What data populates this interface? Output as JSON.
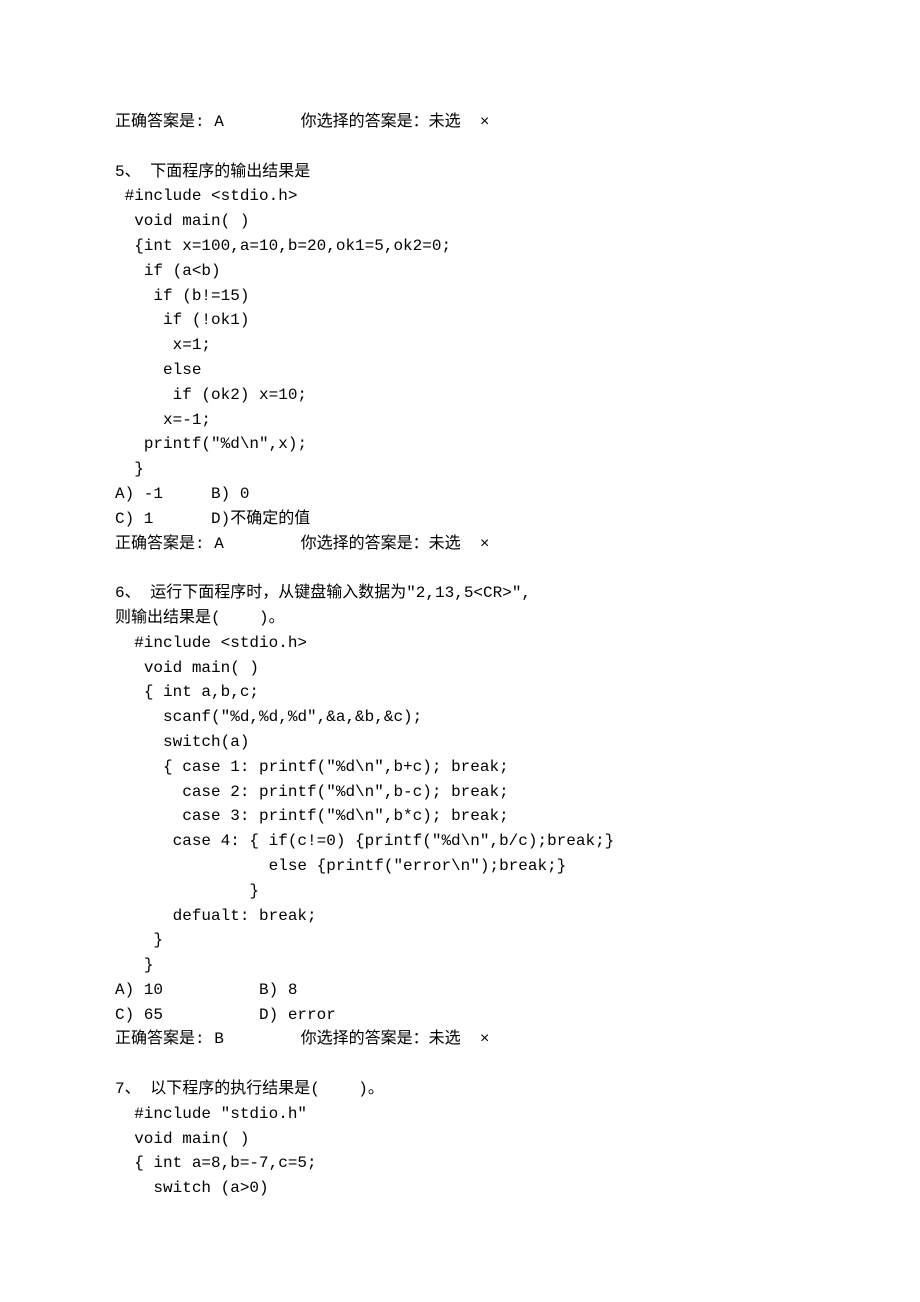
{
  "q4_answer": "正确答案是: A        你选择的答案是：未选  ×",
  "q5": {
    "title": "5、 下面程序的输出结果是",
    "code": " #include <stdio.h>\n  void main( )\n  {int x=100,a=10,b=20,ok1=5,ok2=0;\n   if (a<b)\n    if (b!=15)\n     if (!ok1)\n      x=1;\n     else\n      if (ok2) x=10;\n     x=-1;\n   printf(\"%d\\n\",x);\n  }",
    "options": "A) -1     B) 0\nC) 1      D)不确定的值",
    "answer": "正确答案是: A        你选择的答案是：未选  ×"
  },
  "q6": {
    "title": "6、 运行下面程序时，从键盘输入数据为\"2,13,5<CR>\",\n则输出结果是(    )。",
    "code": "  #include <stdio.h>\n   void main( )\n   { int a,b,c;\n     scanf(\"%d,%d,%d\",&a,&b,&c);\n     switch(a)\n     { case 1: printf(\"%d\\n\",b+c); break;\n       case 2: printf(\"%d\\n\",b-c); break;\n       case 3: printf(\"%d\\n\",b*c); break;\n      case 4: { if(c!=0) {printf(\"%d\\n\",b/c);break;}\n                else {printf(\"error\\n\");break;}\n              }\n      defualt: break;\n    }\n   }",
    "options": "A) 10          B) 8\nC) 65          D) error",
    "answer": "正确答案是: B        你选择的答案是：未选  ×"
  },
  "q7": {
    "title": "7、 以下程序的执行结果是(    )。",
    "code": "  #include \"stdio.h\"\n  void main( )\n  { int a=8,b=-7,c=5;\n    switch (a>0)"
  }
}
